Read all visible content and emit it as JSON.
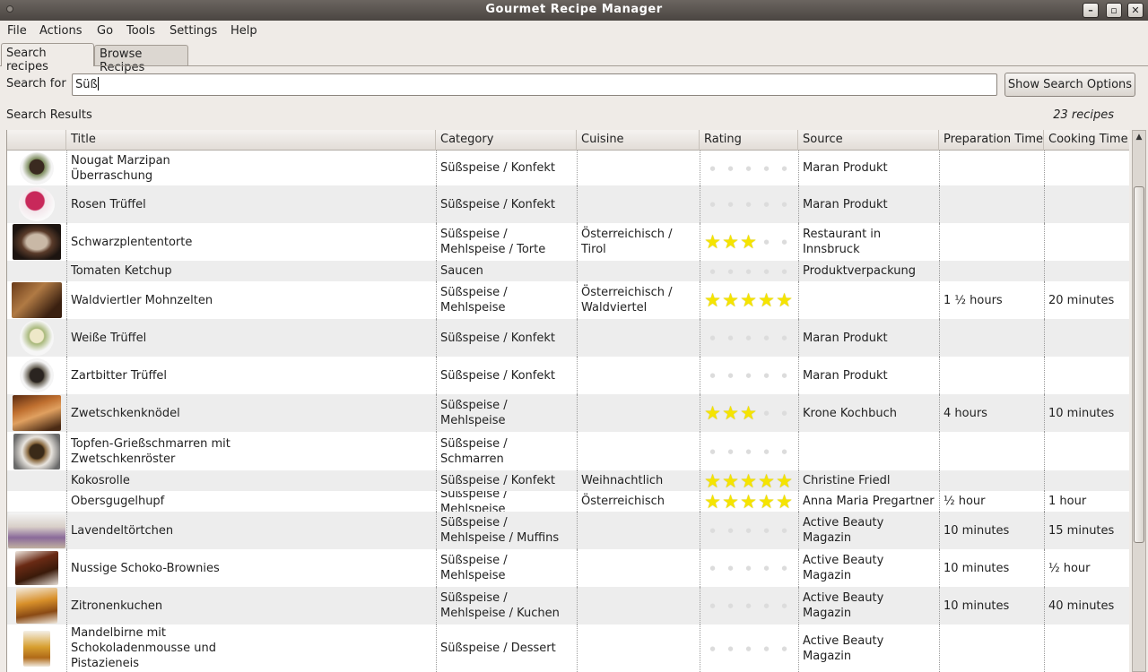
{
  "window": {
    "title": "Gourmet Recipe Manager"
  },
  "menu": [
    "File",
    "Actions",
    "Go",
    "Tools",
    "Settings",
    "Help"
  ],
  "tabs": [
    "Search recipes",
    "Browse Recipes"
  ],
  "search": {
    "label": "Search for",
    "value": "Süß",
    "options_button": "Show Search Options"
  },
  "results": {
    "label": "Search Results",
    "count": "23 recipes"
  },
  "columns": [
    "Title",
    "Category",
    "Cuisine",
    "Rating",
    "Source",
    "Preparation Time",
    "Cooking Time"
  ],
  "rows": [
    {
      "title": "Nougat Marzipan\nÜberraschung",
      "category": "Süßspeise / Konfekt",
      "cuisine": "",
      "rating": 0,
      "source": "Maran Produkt",
      "prep": "",
      "cook": ""
    },
    {
      "title": "Rosen Trüffel",
      "category": "Süßspeise / Konfekt",
      "cuisine": "",
      "rating": 0,
      "source": "Maran Produkt",
      "prep": "",
      "cook": ""
    },
    {
      "title": "Schwarzplententorte",
      "category": "Süßspeise /\nMehlspeise / Torte",
      "cuisine": "Österreichisch / Tirol",
      "rating": 3,
      "source": "Restaurant in Innsbruck",
      "prep": "",
      "cook": ""
    },
    {
      "title": "Tomaten Ketchup",
      "category": "Saucen",
      "cuisine": "",
      "rating": 0,
      "source": "Produktverpackung",
      "prep": "",
      "cook": ""
    },
    {
      "title": "Waldviertler Mohnzelten",
      "category": "Süßspeise / Mehlspeise",
      "cuisine": "Österreichisch /\nWaldviertel",
      "rating": 5,
      "source": "",
      "prep": "1 ½ hours",
      "cook": "20 minutes"
    },
    {
      "title": "Weiße Trüffel",
      "category": "Süßspeise / Konfekt",
      "cuisine": "",
      "rating": 0,
      "source": "Maran Produkt",
      "prep": "",
      "cook": ""
    },
    {
      "title": "Zartbitter Trüffel",
      "category": "Süßspeise / Konfekt",
      "cuisine": "",
      "rating": 0,
      "source": "Maran Produkt",
      "prep": "",
      "cook": ""
    },
    {
      "title": "Zwetschkenknödel",
      "category": "Süßspeise / Mehlspeise",
      "cuisine": "",
      "rating": 3,
      "source": "Krone Kochbuch",
      "prep": "4 hours",
      "cook": "10 minutes"
    },
    {
      "title": "Topfen-Grießschmarren mit\nZwetschkenröster",
      "category": "Süßspeise / Schmarren",
      "cuisine": "",
      "rating": 0,
      "source": "",
      "prep": "",
      "cook": ""
    },
    {
      "title": "Kokosrolle",
      "category": "Süßspeise / Konfekt",
      "cuisine": "Weihnachtlich",
      "rating": 5,
      "source": "Christine Friedl",
      "prep": "",
      "cook": ""
    },
    {
      "title": "Obersgugelhupf",
      "category": "Süßspeise / Mehlspeise",
      "cuisine": "Österreichisch",
      "rating": 5,
      "source": "Anna Maria Pregartner",
      "prep": "½ hour",
      "cook": "1 hour"
    },
    {
      "title": "Lavendeltörtchen",
      "category": "Süßspeise /\nMehlspeise / Muffins",
      "cuisine": "",
      "rating": 0,
      "source": "Active Beauty Magazin",
      "prep": "10 minutes",
      "cook": "15 minutes"
    },
    {
      "title": "Nussige Schoko-Brownies",
      "category": "Süßspeise / Mehlspeise",
      "cuisine": "",
      "rating": 0,
      "source": "Active Beauty Magazin",
      "prep": "10 minutes",
      "cook": "½ hour"
    },
    {
      "title": "Zitronenkuchen",
      "category": "Süßspeise /\nMehlspeise / Kuchen",
      "cuisine": "",
      "rating": 0,
      "source": "Active Beauty Magazin",
      "prep": "10 minutes",
      "cook": "40 minutes"
    },
    {
      "title": "Mandelbirne mit\nSchokoladenmousse und\nPistazieneis",
      "category": "Süßspeise / Dessert",
      "cuisine": "",
      "rating": 0,
      "source": "Active Beauty Magazin",
      "prep": "",
      "cook": ""
    }
  ],
  "colors": {
    "star": "#f5e400",
    "row_alt": "#ededed"
  }
}
